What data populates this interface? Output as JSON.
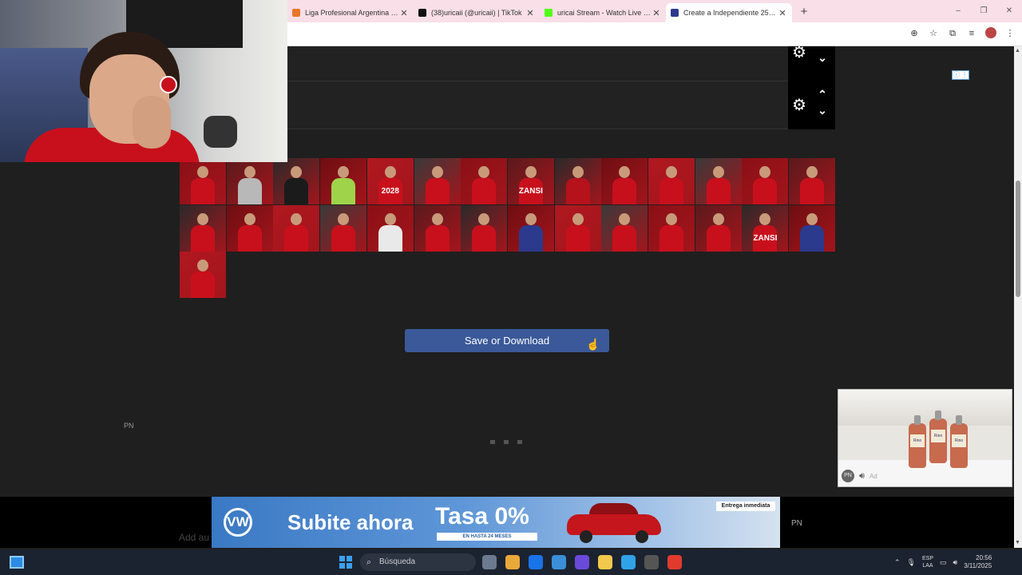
{
  "browser": {
    "tabs": [
      {
        "title": "Liga Profesional Argentina - PC",
        "icon_color": "#e8762b",
        "active": false
      },
      {
        "title": "(38)uricaii (@uricaii) | TikTok",
        "icon_color": "#111111",
        "active": false
      },
      {
        "title": "uricai Stream - Watch Live on K",
        "icon_color": "#53fc18",
        "active": false
      },
      {
        "title": "Create a Independiente 25/25 I",
        "icon_color": "#2b3a8c",
        "active": true
      }
    ],
    "new_tab": "+",
    "window_controls": {
      "minimize": "–",
      "maximize": "❐",
      "close": "✕"
    },
    "toolbar_icons": [
      "zoom-icon",
      "bookmark-star-icon",
      "extensions-icon",
      "media-icon",
      "profile-avatar",
      "menu-icon"
    ]
  },
  "page": {
    "save_button": "Save or Download",
    "pn_label": "PN",
    "ad_badge": "ⓘ ⋮",
    "loading_dots": 3
  },
  "player_grid": {
    "jersey_colors": [
      "#c8101c",
      "#b8b8b8",
      "#1b1b1b",
      "#9ed34a",
      "#c8101c",
      "#c8101c",
      "#c8101c",
      "#c8101c",
      "#b5121b",
      "#c8101c",
      "#c8101c",
      "#c8101c",
      "#c8101c",
      "#c8101c",
      "#c8101c",
      "#c8101c",
      "#c8101c",
      "#c8101c",
      "#e9e9e9",
      "#c8101c",
      "#c8101c",
      "#2b3a8c",
      "#c8101c",
      "#c8101c",
      "#c8101c",
      "#c8101c",
      "#c8101c",
      "#2b3a8c",
      "#c8101c"
    ],
    "tile_labels": {
      "4": "2028",
      "7": "ZANSI",
      "26": "ZANSI"
    }
  },
  "video_ad": {
    "label": "Rino",
    "pn": "PN",
    "ad_text": "Ad"
  },
  "banner": {
    "logo": "VW",
    "headline": "Subite ahora",
    "rate": "Tasa 0%",
    "rate_sub": "EN HASTA 24 MESES",
    "cta": "Entrega inmediata",
    "pn": "PN",
    "underlay_text": "Add au"
  },
  "taskbar": {
    "search_placeholder": "Búsqueda",
    "lang_top": "ESP",
    "lang_bottom": "LAA",
    "time": "20:56",
    "date": "3/11/2025",
    "app_colors": [
      "#6b7a8f",
      "#e8a83a",
      "#1a73e8",
      "#3b8fd8",
      "#6a4ad8",
      "#f2c94c",
      "#2fa3e8",
      "#555555",
      "#e23b2e"
    ]
  }
}
